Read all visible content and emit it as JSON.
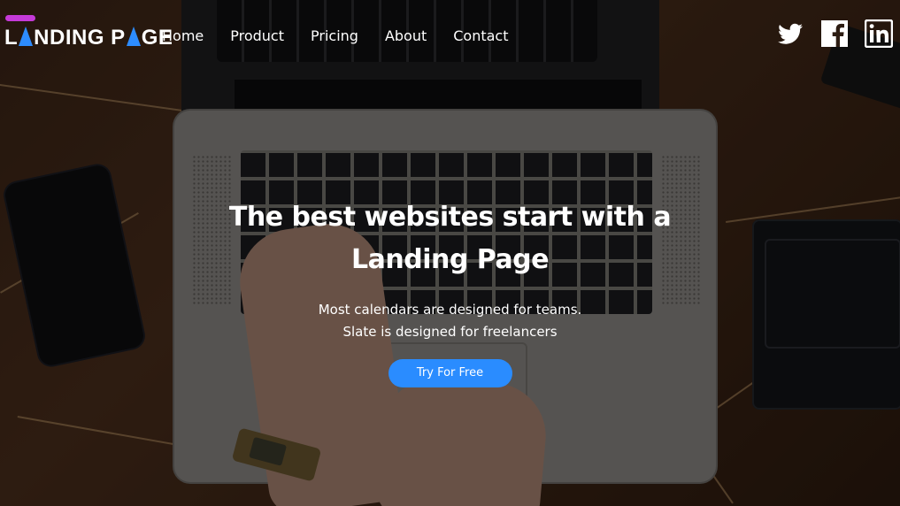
{
  "header": {
    "logo": {
      "text_part1": "L",
      "text_part2": "NDING P",
      "text_part3": "GE"
    },
    "nav": [
      {
        "label": "Home"
      },
      {
        "label": "Product"
      },
      {
        "label": "Pricing"
      },
      {
        "label": "About"
      },
      {
        "label": "Contact"
      }
    ],
    "social": [
      {
        "icon": "twitter-icon"
      },
      {
        "icon": "facebook-icon"
      },
      {
        "icon": "linkedin-icon"
      }
    ]
  },
  "hero": {
    "title": "The best websites start with a Landing Page",
    "subtitle_line1": "Most calendars are designed for teams.",
    "subtitle_line2": "Slate is designed for freelancers",
    "cta_label": "Try For Free"
  },
  "colors": {
    "accent": "#2a8cff",
    "logo_mark": "#c53ad8",
    "text": "#ffffff"
  }
}
